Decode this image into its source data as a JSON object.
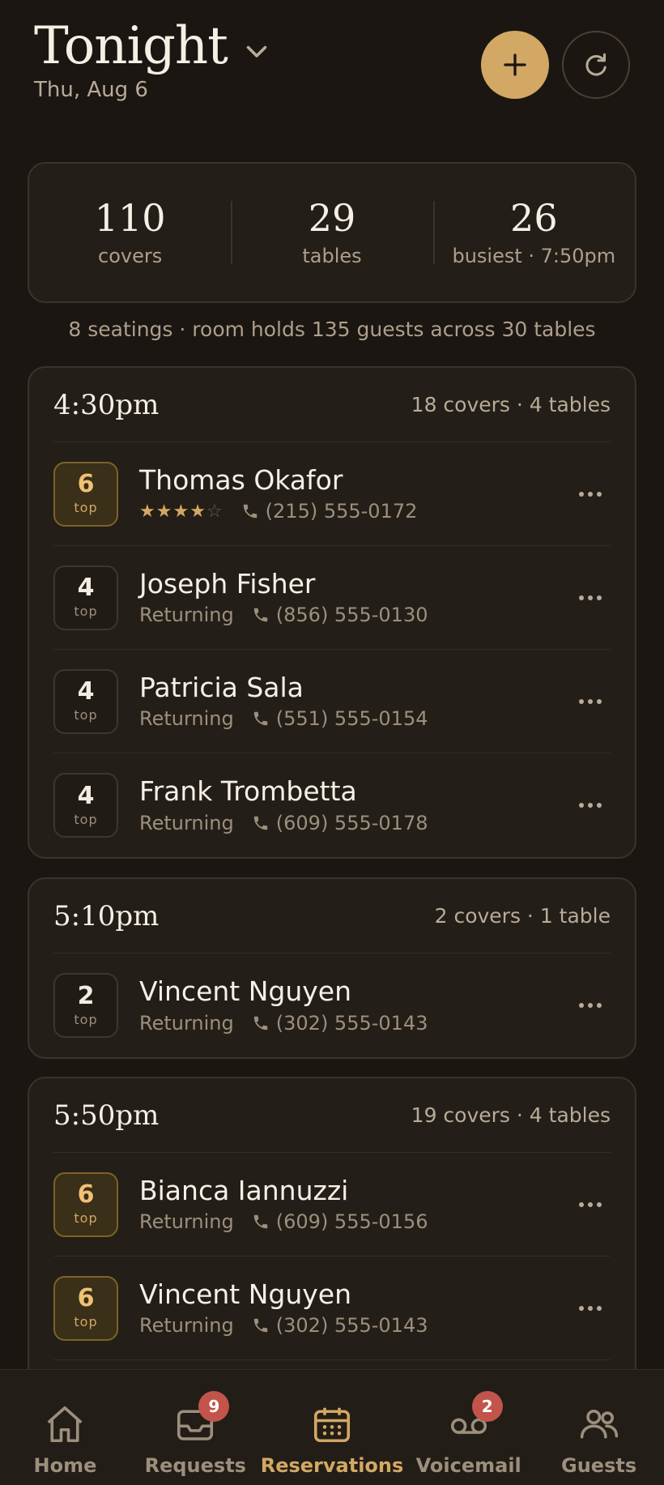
{
  "header": {
    "title": "Tonight",
    "date": "Thu, Aug 6"
  },
  "stats": [
    {
      "value": "110",
      "label": "covers"
    },
    {
      "value": "29",
      "label": "tables"
    },
    {
      "value": "26",
      "label": "busiest · 7:50pm"
    }
  ],
  "summary": "8 seatings · room holds 135 guests across 30 tables",
  "seatings": [
    {
      "time": "4:30pm",
      "meta": "18 covers · 4 tables",
      "reservations": [
        {
          "party": "6",
          "unit": "top",
          "name": "Thomas Okafor",
          "status": "",
          "rating": 4,
          "phone": "(215) 555-0172",
          "highlight": true
        },
        {
          "party": "4",
          "unit": "top",
          "name": "Joseph Fisher",
          "status": "Returning",
          "phone": "(856) 555-0130",
          "highlight": false
        },
        {
          "party": "4",
          "unit": "top",
          "name": "Patricia Sala",
          "status": "Returning",
          "phone": "(551) 555-0154",
          "highlight": false
        },
        {
          "party": "4",
          "unit": "top",
          "name": "Frank Trombetta",
          "status": "Returning",
          "phone": "(609) 555-0178",
          "highlight": false
        }
      ]
    },
    {
      "time": "5:10pm",
      "meta": "2 covers · 1 table",
      "reservations": [
        {
          "party": "2",
          "unit": "top",
          "name": "Vincent Nguyen",
          "status": "Returning",
          "phone": "(302) 555-0143",
          "highlight": false
        }
      ]
    },
    {
      "time": "5:50pm",
      "meta": "19 covers · 4 tables",
      "reservations": [
        {
          "party": "6",
          "unit": "top",
          "name": "Bianca Iannuzzi",
          "status": "Returning",
          "phone": "(609) 555-0156",
          "highlight": true
        },
        {
          "party": "6",
          "unit": "top",
          "name": "Vincent Nguyen",
          "status": "Returning",
          "phone": "(302) 555-0143",
          "highlight": true
        }
      ]
    }
  ],
  "nav": [
    {
      "label": "Home",
      "icon": "home-icon",
      "badge": ""
    },
    {
      "label": "Requests",
      "icon": "inbox-icon",
      "badge": "9"
    },
    {
      "label": "Reservations",
      "icon": "calendar-icon",
      "badge": "",
      "active": true
    },
    {
      "label": "Voicemail",
      "icon": "voicemail-icon",
      "badge": "2"
    },
    {
      "label": "Guests",
      "icon": "guests-icon",
      "badge": ""
    }
  ],
  "colors": {
    "accent": "#d3a864",
    "background": "#1b1612",
    "card": "#241e18",
    "badge": "#c2544c"
  }
}
